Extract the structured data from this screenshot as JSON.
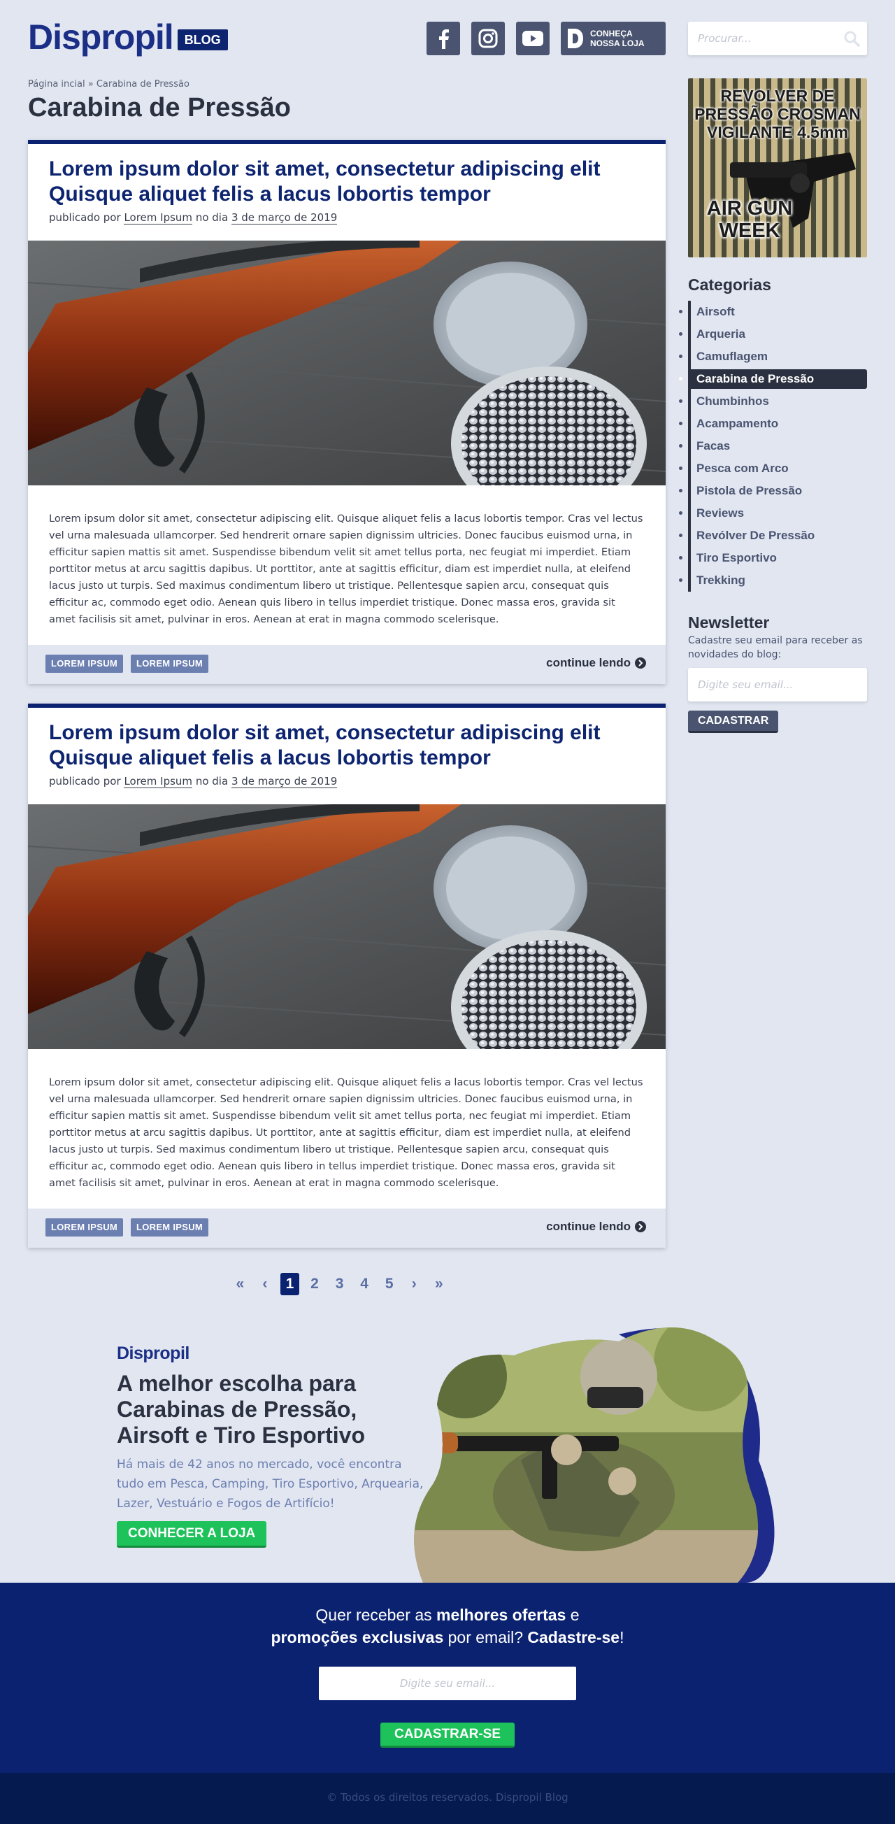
{
  "header": {
    "logo": "Dispropil",
    "logo_badge": "BLOG",
    "social": [
      "facebook-icon",
      "instagram-icon",
      "youtube-icon"
    ],
    "store_button": "CONHEÇA\nNOSSA LOJA",
    "search_placeholder": "Procurar..."
  },
  "breadcrumb": "Página incial » Carabina de Pressão",
  "page_title": "Carabina de Pressão",
  "posts": [
    {
      "title": "Lorem ipsum dolor sit amet, consectetur adipiscing elit Quisque aliquet felis a lacus lobortis tempor",
      "meta_prefix": "publicado por",
      "author": "Lorem Ipsum",
      "meta_middle": "no dia",
      "date": "3 de março de 2019",
      "excerpt": "Lorem ipsum dolor sit amet, consectetur adipiscing elit. Quisque aliquet felis a lacus lobortis tempor. Cras vel lectus vel urna malesuada ullamcorper. Sed hendrerit ornare sapien dignissim ultricies. Donec faucibus euismod urna, in efficitur sapien mattis sit amet. Suspendisse bibendum velit sit amet tellus porta, nec feugiat mi imperdiet. Etiam porttitor metus at arcu sagittis dapibus. Ut porttitor, ante at sagittis efficitur, diam est imperdiet nulla, at eleifend lacus justo ut turpis. Sed maximus condimentum libero ut tristique. Pellentesque sapien arcu, consequat quis efficitur ac, commodo eget odio. Aenean quis libero in tellus imperdiet tristique. Donec massa eros, gravida sit amet facilisis sit amet, pulvinar in eros. Aenean at erat in magna commodo scelerisque.",
      "tags": [
        "LOREM IPSUM",
        "LOREM IPSUM"
      ],
      "continue": "continue lendo"
    },
    {
      "title": "Lorem ipsum dolor sit amet, consectetur adipiscing elit Quisque aliquet felis a lacus lobortis tempor",
      "meta_prefix": "publicado por",
      "author": "Lorem Ipsum",
      "meta_middle": "no dia",
      "date": "3 de março de 2019",
      "excerpt": "Lorem ipsum dolor sit amet, consectetur adipiscing elit. Quisque aliquet felis a lacus lobortis tempor. Cras vel lectus vel urna malesuada ullamcorper. Sed hendrerit ornare sapien dignissim ultricies. Donec faucibus euismod urna, in efficitur sapien mattis sit amet. Suspendisse bibendum velit sit amet tellus porta, nec feugiat mi imperdiet. Etiam porttitor metus at arcu sagittis dapibus. Ut porttitor, ante at sagittis efficitur, diam est imperdiet nulla, at eleifend lacus justo ut turpis. Sed maximus condimentum libero ut tristique. Pellentesque sapien arcu, consequat quis efficitur ac, commodo eget odio. Aenean quis libero in tellus imperdiet tristique. Donec massa eros, gravida sit amet facilisis sit amet, pulvinar in eros. Aenean at erat in magna commodo scelerisque.",
      "tags": [
        "LOREM IPSUM",
        "LOREM IPSUM"
      ],
      "continue": "continue lendo"
    }
  ],
  "pagination": {
    "pages": [
      "1",
      "2",
      "3",
      "4",
      "5"
    ],
    "current": "1"
  },
  "sidebar": {
    "ad_title": "REVOLVER DE\nPRESSÃO CROSMAN\nVIGILANTE 4.5mm",
    "ad_subtitle": "AIR GUN\nWEEK",
    "categories_heading": "Categorias",
    "categories": [
      "Airsoft",
      "Arqueria",
      "Camuflagem",
      "Carabina de Pressão",
      "Chumbinhos",
      "Acampamento",
      "Facas",
      "Pesca com Arco",
      "Pistola de Pressão",
      "Reviews",
      "Revólver De Pressão",
      "Tiro Esportivo",
      "Trekking"
    ],
    "active_category": "Carabina de Pressão",
    "newsletter_heading": "Newsletter",
    "newsletter_desc": "Cadastre seu email para receber as novidades do blog:",
    "newsletter_placeholder": "Digite seu email...",
    "newsletter_button": "CADASTRAR"
  },
  "promo": {
    "logo": "Dispropil",
    "title": "A melhor escolha para\nCarabinas de Pressão,\nAirsoft e Tiro Esportivo",
    "description": "Há mais de 42 anos no mercado, você encontra tudo em Pesca, Camping, Tiro Esportivo, Arquearia, Lazer, Vestuário e Fogos de Artifício!",
    "button": "CONHECER A LOJA"
  },
  "subscribe": {
    "line1_a": "Quer receber as ",
    "line1_b": "melhores ofertas",
    "line1_c": " e",
    "line2_a": "promoções exclusivas",
    "line2_b": " por email? ",
    "line2_c": "Cadastre-se",
    "line2_d": "!",
    "placeholder": "Digite seu email...",
    "button": "CADASTRAR-SE"
  },
  "footer": {
    "copyright": "© Todos os direitos reservados. Dispropil Blog"
  },
  "colors": {
    "navy": "#0b2271",
    "slate": "#4a5470",
    "page_bg": "#e1e6f1",
    "green": "#1dc25a",
    "tag_blue": "#6c7fb1"
  }
}
